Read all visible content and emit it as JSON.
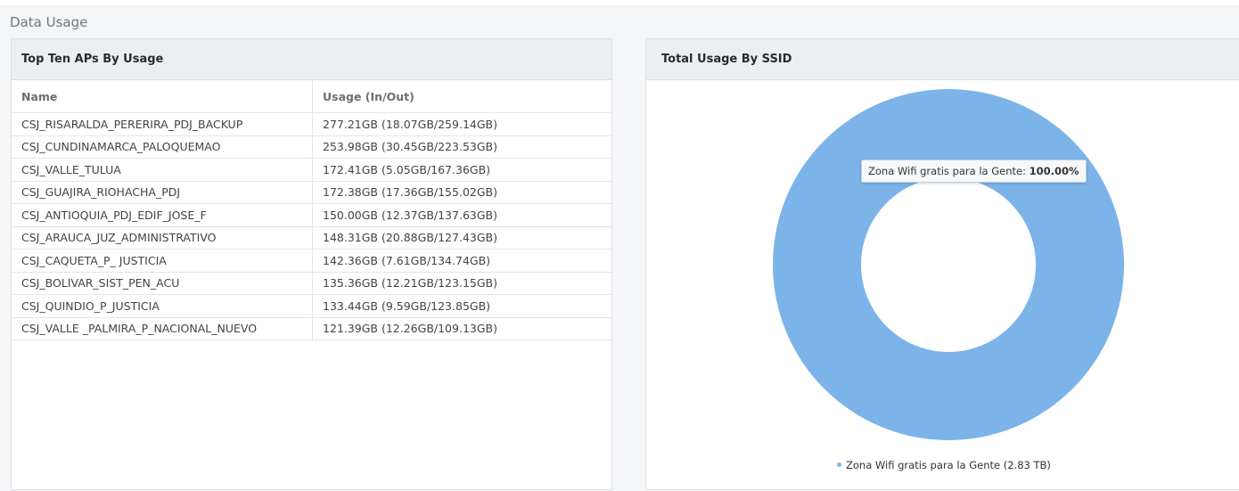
{
  "page": {
    "section_title": "Data Usage"
  },
  "top_aps": {
    "title": "Top Ten APs By Usage",
    "columns": [
      "Name",
      "Usage (In/Out)"
    ],
    "rows": [
      {
        "name": "CSJ_RISARALDA_PERERIRA_PDJ_BACKUP",
        "usage": "277.21GB (18.07GB/259.14GB)"
      },
      {
        "name": "CSJ_CUNDINAMARCA_PALOQUEMAO",
        "usage": "253.98GB (30.45GB/223.53GB)"
      },
      {
        "name": "CSJ_VALLE_TULUA",
        "usage": "172.41GB (5.05GB/167.36GB)"
      },
      {
        "name": "CSJ_GUAJIRA_RIOHACHA_PDJ",
        "usage": "172.38GB (17.36GB/155.02GB)"
      },
      {
        "name": "CSJ_ANTIOQUIA_PDJ_EDIF_JOSE_F",
        "usage": "150.00GB (12.37GB/137.63GB)"
      },
      {
        "name": "CSJ_ARAUCA_JUZ_ADMINISTRATIVO",
        "usage": "148.31GB (20.88GB/127.43GB)"
      },
      {
        "name": "CSJ_CAQUETA_P_ JUSTICIA",
        "usage": "142.36GB (7.61GB/134.74GB)"
      },
      {
        "name": "CSJ_BOLIVAR_SIST_PEN_ACU",
        "usage": "135.36GB (12.21GB/123.15GB)"
      },
      {
        "name": "CSJ_QUINDIO_P_JUSTICIA",
        "usage": "133.44GB (9.59GB/123.85GB)"
      },
      {
        "name": "CSJ_VALLE _PALMIRA_P_NACIONAL_NUEVO",
        "usage": "121.39GB (12.26GB/109.13GB)"
      }
    ]
  },
  "ssid_usage": {
    "title": "Total Usage By SSID",
    "tooltip": {
      "label": "Zona Wifi gratis para la Gente:",
      "value": "100.00%"
    },
    "legend_label": "Zona Wifi gratis para la Gente (2.83 TB)",
    "color": "#7cb4e9"
  },
  "chart_data": {
    "type": "pie",
    "variant": "donut",
    "title": "Total Usage By SSID",
    "slices": [
      {
        "label": "Zona Wifi gratis para la Gente",
        "value": 2.83,
        "unit": "TB",
        "percent": 100.0
      }
    ],
    "legend_position": "bottom",
    "colors": [
      "#7cb4e9"
    ]
  }
}
